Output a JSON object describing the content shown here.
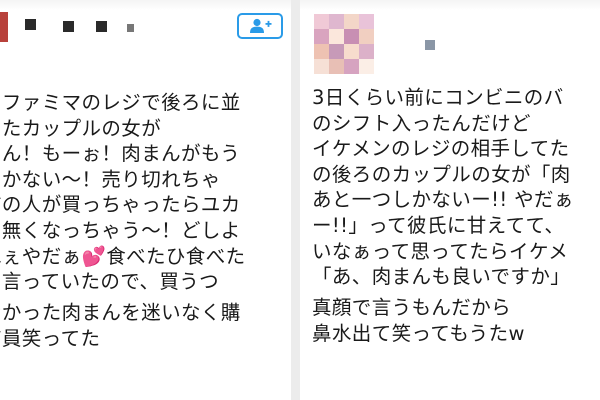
{
  "left_tweet": {
    "lines": [
      "のファミマのレジで後ろに並",
      "いたカップルの女が",
      "ーん！もーぉ！肉まんがもう",
      "しかない〜！売り切れちゃ",
      "前の人が買っちゃったらユカ",
      "の無くなっちゃう〜！どしよ",
      "ぬぇやだぁ",
      "と言っていたので、買うつ",
      "なかった肉まんを迷いなく購",
      "店員笑ってた"
    ],
    "line7_rest": "食べたひ食べた",
    "heart": "💕"
  },
  "right_tweet": {
    "lines": [
      "3日くらい前にコンビニのバ",
      "のシフト入ったんだけど",
      "イケメンのレジの相手してた",
      "の後ろのカップルの女が「肉",
      "あと一つしかないー!! やだぁ",
      "ー!!」って彼氏に甘えてて、",
      "いなぁって思ってたらイケメ",
      "「あ、肉まんも良いですか」",
      "真顔で言うもんだから",
      "鼻水出て笑ってもうたw"
    ]
  },
  "colors": {
    "follow_accent": "#2a9be8",
    "avatar_left": "#b8413b",
    "heart": "#ec3f8c"
  },
  "icons": {
    "follow": "add-user-icon"
  }
}
